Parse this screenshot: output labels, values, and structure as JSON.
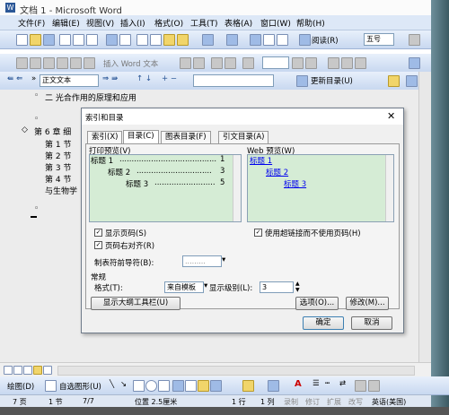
{
  "window": {
    "title": "文档 1 - Microsoft Word"
  },
  "menu": [
    "文件(F)",
    "编辑(E)",
    "视图(V)",
    "插入(I)",
    "格式(O)",
    "工具(T)",
    "表格(A)",
    "窗口(W)",
    "帮助(H)"
  ],
  "toolbar1": {
    "read_label": "阅读(R)",
    "font_size": "五号"
  },
  "toolbar2": {
    "insert_word_label": "插入 Word 文本"
  },
  "toolbar3": {
    "style": "正文文本",
    "update_toc_label": "更新目录(U)"
  },
  "document": {
    "lines": [
      "二  光合作用的原理和应用",
      "第 6 章  细",
      "第 1 节",
      "第 2 节",
      "第 3 节",
      "第 4 节",
      "与生物学"
    ]
  },
  "dialog": {
    "title": "索引和目录",
    "tabs": [
      "索引(X)",
      "目录(C)",
      "图表目录(F)",
      "引文目录(A)"
    ],
    "print_preview_label": "打印预览(V)",
    "print_preview": [
      {
        "text": "标题 1",
        "page": "1"
      },
      {
        "text": "标题 2",
        "page": "3"
      },
      {
        "text": "标题 3",
        "page": "5"
      }
    ],
    "web_preview_label": "Web 预览(W)",
    "web_preview": [
      "标题 1",
      "标题 2",
      "标题 3"
    ],
    "show_page_numbers": "显示页码(S)",
    "right_align": "页码右对齐(R)",
    "leader_label": "制表符前导符(B):",
    "leader_value": ".........",
    "use_hyperlinks": "使用超链接而不使用页码(H)",
    "general_label": "常规",
    "format_label": "格式(T):",
    "format_value": "来自模板",
    "levels_label": "显示级别(L):",
    "levels_value": "3",
    "outline_toolbar_btn": "显示大纲工具栏(U)",
    "options_btn": "选项(O)...",
    "modify_btn": "修改(M)...",
    "ok_btn": "确定",
    "cancel_btn": "取消"
  },
  "drawbar": {
    "draw_label": "绘图(D)",
    "autoshape_label": "自选图形(U)"
  },
  "status": {
    "page": "7 页",
    "section": "1 节",
    "pages": "7/7",
    "position": "位置 2.5厘米",
    "line": "1 行",
    "col": "1 列",
    "rec": "录制",
    "trk": "修订",
    "ext": "扩展",
    "ovr": "改写",
    "lang": "英语(美国)"
  }
}
